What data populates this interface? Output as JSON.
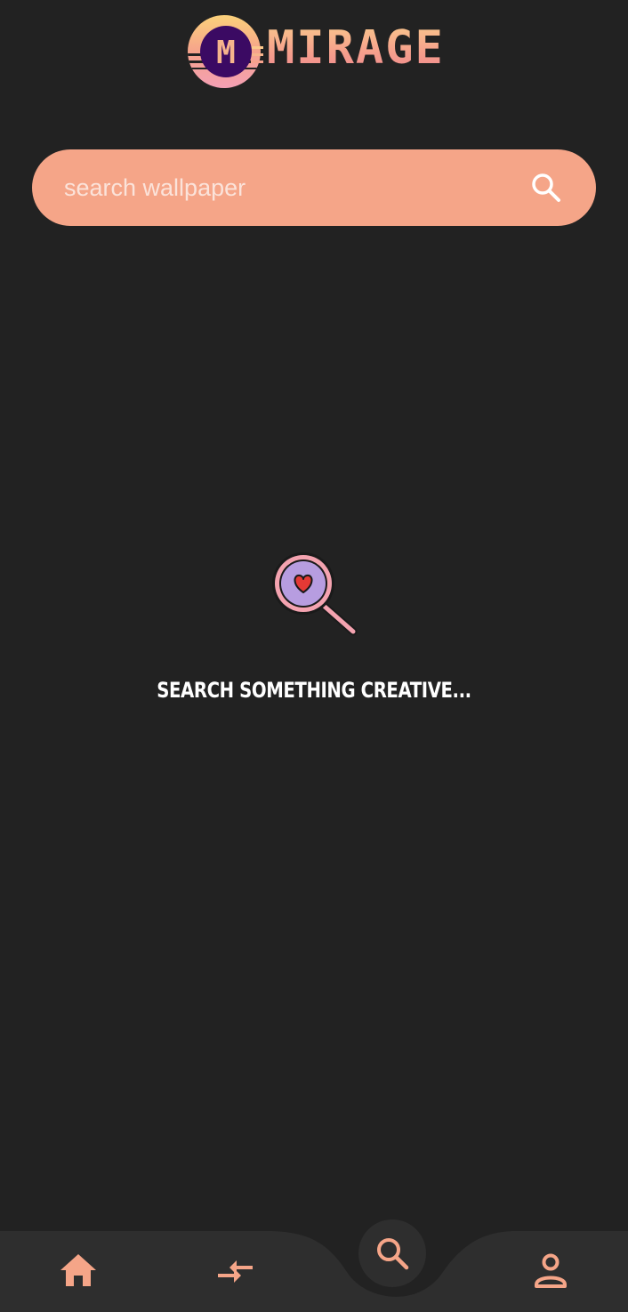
{
  "app": {
    "name": "MIRAGE",
    "logo_letter": "M"
  },
  "search": {
    "placeholder": "search wallpaper",
    "value": ""
  },
  "empty_state": {
    "message": "SEARCH SOMETHING CREATIVE..."
  },
  "bottom_nav": {
    "items": [
      {
        "id": "home",
        "icon": "home-icon"
      },
      {
        "id": "compare",
        "icon": "compare-arrows-icon"
      },
      {
        "id": "search",
        "icon": "search-icon",
        "active": true
      },
      {
        "id": "profile",
        "icon": "person-icon"
      }
    ]
  },
  "colors": {
    "background": "#222222",
    "accent": "#f5a588",
    "nav_background": "#2e2e2e",
    "logo_purple": "#3b0a63",
    "illustration_lens": "#b79de0",
    "heart": "#e53935"
  }
}
